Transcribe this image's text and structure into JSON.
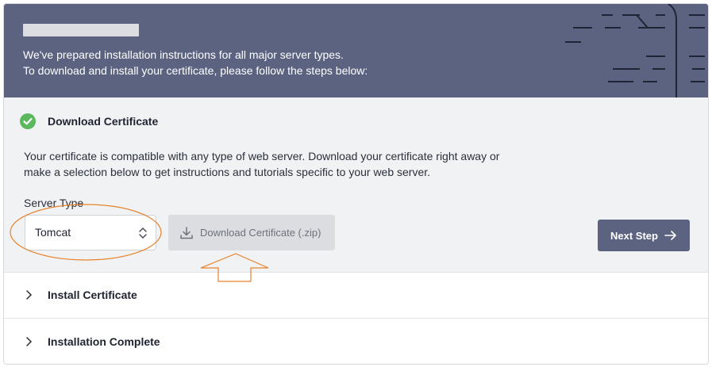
{
  "header": {
    "line1": "We've prepared installation instructions for all major server types.",
    "line2": "To download and install your certificate, please follow the steps below:"
  },
  "steps": [
    {
      "title": "Download Certificate",
      "status": "completed",
      "description": "Your certificate is compatible with any type of web server. Download your certificate right away or make a selection below to get instructions and tutorials specific to your web server.",
      "server_type_label": "Server Type",
      "server_type_value": "Tomcat",
      "download_label": "Download Certificate (.zip)",
      "next_label": "Next Step",
      "next_icon": "arrow-right-icon"
    },
    {
      "title": "Install Certificate",
      "status": "collapsed"
    },
    {
      "title": "Installation Complete",
      "status": "collapsed"
    }
  ],
  "colors": {
    "header_bg": "#5b6380",
    "step_bg": "#f1f2f4",
    "success": "#5cb85c",
    "annotation": "#e8822a",
    "button_disabled_bg": "#dcdde0"
  }
}
